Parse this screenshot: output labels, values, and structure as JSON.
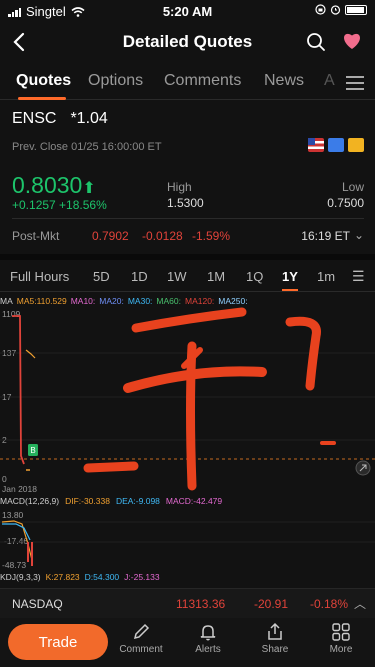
{
  "status_bar": {
    "carrier": "Singtel",
    "time": "5:20 AM",
    "icons": [
      "signal-icon",
      "wifi-icon",
      "orientation-lock-icon",
      "alarm-icon",
      "battery-icon"
    ]
  },
  "nav": {
    "title": "Detailed Quotes",
    "icons": [
      "back-arrow-icon",
      "search-icon",
      "heart-icon"
    ]
  },
  "tabs": [
    {
      "label": "Quotes",
      "active": true
    },
    {
      "label": "Options",
      "active": false
    },
    {
      "label": "Comments",
      "active": false
    },
    {
      "label": "News",
      "active": false
    },
    {
      "label": "A",
      "active": false
    }
  ],
  "quote": {
    "symbol": "ENSC",
    "star_value": "*1.04",
    "prev_close": "Prev. Close 01/25 16:00:00 ET",
    "price": "0.8030",
    "change": "+0.1257 +18.56%",
    "high_label": "High",
    "high_value": "1.5300",
    "low_label": "Low",
    "low_value": "0.7500",
    "badges": [
      "us-flag-icon",
      "flash-icon",
      "document-icon"
    ]
  },
  "post_market": {
    "label": "Post-Mkt",
    "price": "0.7902",
    "change": "-0.0128",
    "percent": "-1.59%",
    "time": "16:19 ET"
  },
  "periods": [
    {
      "label": "Full Hours",
      "active": false
    },
    {
      "label": "5D",
      "active": false
    },
    {
      "label": "1D",
      "active": false
    },
    {
      "label": "1W",
      "active": false
    },
    {
      "label": "1M",
      "active": false
    },
    {
      "label": "1Q",
      "active": false
    },
    {
      "label": "1Y",
      "active": true
    },
    {
      "label": "1m",
      "active": false
    }
  ],
  "ma_indicators": [
    {
      "label": "MA",
      "color": "#cfcfcf"
    },
    {
      "label": "MA5:110.529",
      "color": "#f0a030"
    },
    {
      "label": "MA10:",
      "color": "#e46ad1"
    },
    {
      "label": "MA20:",
      "color": "#6f8ff6"
    },
    {
      "label": "MA30:",
      "color": "#3fb9f5"
    },
    {
      "label": "MA60:",
      "color": "#49c06d"
    },
    {
      "label": "MA120:",
      "color": "#e0433a"
    },
    {
      "label": "MA250:",
      "color": "#8fd0ff"
    }
  ],
  "chart": {
    "y_labels": [
      "1109",
      "137",
      "17",
      "2",
      "0"
    ],
    "x_label": "Jan 2018",
    "marker": "B",
    "annotation_color": "#e8421e"
  },
  "macd": {
    "label": "MACD(12,26,9)",
    "dif": "DIF:-30.338",
    "dea": "DEA:-9.098",
    "macd": "MACD:-42.479",
    "y_labels": [
      "13.80",
      "-17.46",
      "-48.73"
    ]
  },
  "kdj": {
    "label": "KDJ(9,3,3)",
    "k": "K:27.823",
    "d": "D:54.300",
    "j": "J:-25.133"
  },
  "index_bar": {
    "name": "NASDAQ",
    "value": "11313.36",
    "change": "-20.91",
    "percent": "-0.18%"
  },
  "bottom_bar": {
    "trade_label": "Trade",
    "actions": [
      {
        "label": "Comment",
        "icon": "pencil-icon"
      },
      {
        "label": "Alerts",
        "icon": "bell-icon"
      },
      {
        "label": "Share",
        "icon": "share-icon"
      },
      {
        "label": "More",
        "icon": "grid-icon"
      }
    ]
  }
}
